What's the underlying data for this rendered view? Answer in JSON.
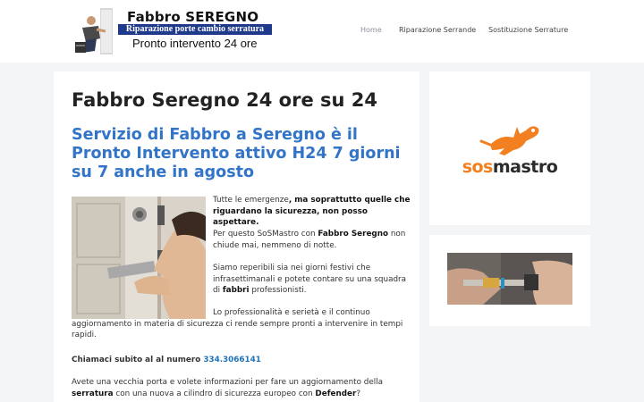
{
  "header": {
    "logo": {
      "title": "Fabbro SEREGNO",
      "band": "Riparazione porte cambio serratura",
      "subtitle": "Pronto intervento 24 ore"
    },
    "nav": [
      "Home",
      "Riparazione Serrande",
      "Sostituzione Serrature"
    ]
  },
  "main": {
    "title": "Fabbro Seregno 24 ore su 24",
    "subtitle": "Servizio di Fabbro a Seregno è il Pronto Intervento attivo H24 7 giorni su 7 anche in agosto",
    "p1": {
      "a": "Tutte le emergenze",
      "b": ", ma soprattutto quelle che riguardano la sicurezza, non posso aspettare."
    },
    "p2": {
      "a": "Per questo SoSMastro con ",
      "b": "Fabbro Seregno",
      "c": " non chiude mai, nemmeno di notte."
    },
    "p3": {
      "a": "Siamo reperibili sia nei giorni festivi che infrasettimanali e potete contare su una squadra di ",
      "b": "fabbri",
      "c": " professionisti."
    },
    "p4": {
      "a": "Lo professionalità e serietà e il continuo aggiornamento in materia di sicurezza ci rende sempre pronti  a intervenire in tempi rapidi."
    },
    "p5": {
      "a": "Chiamaci subito al al numero ",
      "phone": "334.3066141"
    },
    "p6": {
      "a": "Avete una vecchia porta e volete informazioni per fare un aggiornamento della ",
      "b": "serratura",
      "c": " con una nuova a cilindro di sicurezza europeo con ",
      "d": "Defender",
      "e": "?"
    }
  },
  "sidebar": {
    "brand_a": "sos",
    "brand_b": "mastro"
  },
  "colors": {
    "accent_blue": "#3275c8",
    "link_blue": "#1e73be",
    "brand_orange": "#f28020",
    "logo_band": "#1f3a8a"
  }
}
